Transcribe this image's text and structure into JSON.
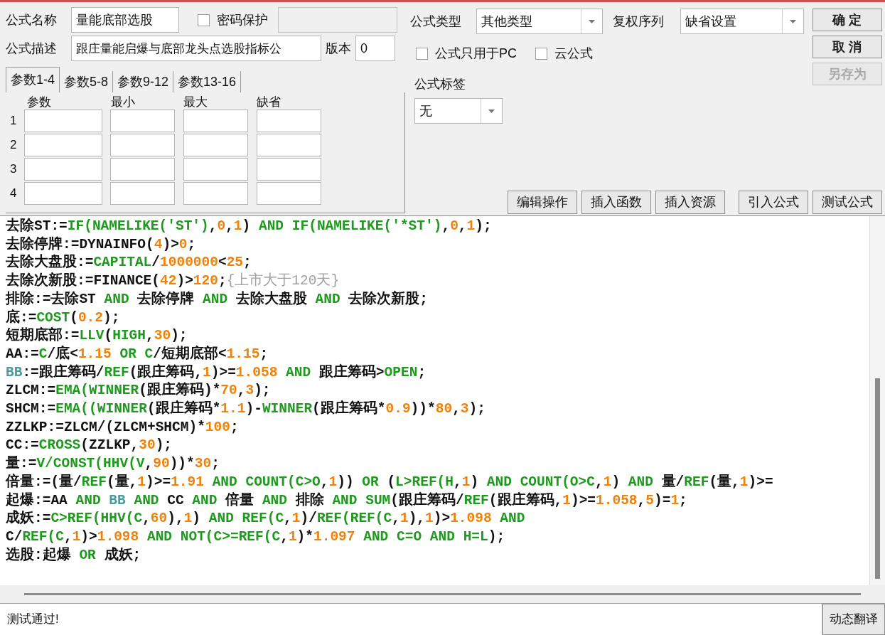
{
  "formula_name": {
    "label": "公式名称",
    "value": "量能底部选股"
  },
  "password": {
    "label": "密码保护",
    "checked": false
  },
  "description": {
    "label": "公式描述",
    "value": "跟庄量能启爆与底部龙头点选股指标公"
  },
  "version": {
    "label": "版本",
    "value": "0"
  },
  "param_tabs": [
    {
      "label": "参数1-4",
      "selected": true
    },
    {
      "label": "参数5-8",
      "selected": false
    },
    {
      "label": "参数9-12",
      "selected": false
    },
    {
      "label": "参数13-16",
      "selected": false
    }
  ],
  "param_table": {
    "columns": [
      "参数",
      "最小",
      "最大",
      "缺省"
    ],
    "rows": [
      "1",
      "2",
      "3",
      "4"
    ]
  },
  "formula_type": {
    "label": "公式类型",
    "value": "其他类型"
  },
  "adjust_sequence": {
    "label": "复权序列",
    "value": "缺省设置"
  },
  "options": [
    {
      "label": "公式只用于PC",
      "checked": false
    },
    {
      "label": "云公式",
      "checked": false
    }
  ],
  "formula_tag": {
    "label": "公式标签",
    "value": "无"
  },
  "dialog_buttons": [
    {
      "label": "确 定",
      "disabled": false
    },
    {
      "label": "取 消",
      "disabled": false
    },
    {
      "label": "另存为",
      "disabled": true
    }
  ],
  "tool_buttons": [
    "编辑操作",
    "插入函数",
    "插入资源",
    "引入公式",
    "测试公式"
  ],
  "code_lines": [
    {
      "tokens": [
        {
          "kind": "text",
          "text": "去除ST:="
        },
        {
          "kind": "function",
          "text": "IF(NAMELIKE('ST')"
        },
        {
          "kind": "text",
          "text": ","
        },
        {
          "kind": "number",
          "text": "0"
        },
        {
          "kind": "text",
          "text": ","
        },
        {
          "kind": "number",
          "text": "1"
        },
        {
          "kind": "text",
          "text": ") "
        },
        {
          "kind": "function",
          "text": "AND IF(NAMELIKE('*ST')"
        },
        {
          "kind": "text",
          "text": ","
        },
        {
          "kind": "number",
          "text": "0"
        },
        {
          "kind": "text",
          "text": ","
        },
        {
          "kind": "number",
          "text": "1"
        },
        {
          "kind": "text",
          "text": ");"
        }
      ]
    },
    {
      "tokens": [
        {
          "kind": "text",
          "text": "去除停牌:=DYNAINFO("
        },
        {
          "kind": "number",
          "text": "4"
        },
        {
          "kind": "text",
          "text": ")>"
        },
        {
          "kind": "number",
          "text": "0"
        },
        {
          "kind": "text",
          "text": ";"
        }
      ]
    },
    {
      "tokens": [
        {
          "kind": "text",
          "text": "去除大盘股:="
        },
        {
          "kind": "function",
          "text": "CAPITAL"
        },
        {
          "kind": "text",
          "text": "/"
        },
        {
          "kind": "number",
          "text": "1000000"
        },
        {
          "kind": "text",
          "text": "<"
        },
        {
          "kind": "number",
          "text": "25"
        },
        {
          "kind": "text",
          "text": ";"
        }
      ]
    },
    {
      "tokens": [
        {
          "kind": "text",
          "text": "去除次新股:=FINANCE("
        },
        {
          "kind": "number",
          "text": "42"
        },
        {
          "kind": "text",
          "text": ")>"
        },
        {
          "kind": "number",
          "text": "120"
        },
        {
          "kind": "text",
          "text": ";"
        },
        {
          "kind": "comment",
          "text": "{上市大于120天}"
        }
      ]
    },
    {
      "tokens": [
        {
          "kind": "text",
          "text": "排除:=去除ST "
        },
        {
          "kind": "function",
          "text": "AND"
        },
        {
          "kind": "text",
          "text": " 去除停牌 "
        },
        {
          "kind": "function",
          "text": "AND"
        },
        {
          "kind": "text",
          "text": " 去除大盘股 "
        },
        {
          "kind": "function",
          "text": "AND"
        },
        {
          "kind": "text",
          "text": " 去除次新股;"
        }
      ]
    },
    {
      "tokens": [
        {
          "kind": "text",
          "text": "底:="
        },
        {
          "kind": "function",
          "text": "COST"
        },
        {
          "kind": "text",
          "text": "("
        },
        {
          "kind": "number",
          "text": "0.2"
        },
        {
          "kind": "text",
          "text": ");"
        }
      ]
    },
    {
      "tokens": [
        {
          "kind": "text",
          "text": "短期底部:="
        },
        {
          "kind": "function",
          "text": "LLV"
        },
        {
          "kind": "text",
          "text": "("
        },
        {
          "kind": "function",
          "text": "HIGH"
        },
        {
          "kind": "text",
          "text": ","
        },
        {
          "kind": "number",
          "text": "30"
        },
        {
          "kind": "text",
          "text": ");"
        }
      ]
    },
    {
      "tokens": [
        {
          "kind": "text",
          "text": "AA:="
        },
        {
          "kind": "function",
          "text": "C"
        },
        {
          "kind": "text",
          "text": "/底<"
        },
        {
          "kind": "number",
          "text": "1.15"
        },
        {
          "kind": "function",
          "text": " OR C"
        },
        {
          "kind": "text",
          "text": "/短期底部<"
        },
        {
          "kind": "number",
          "text": "1.15"
        },
        {
          "kind": "text",
          "text": ";"
        }
      ]
    },
    {
      "tokens": [
        {
          "kind": "variable",
          "text": "BB"
        },
        {
          "kind": "text",
          "text": ":=跟庄筹码/"
        },
        {
          "kind": "function",
          "text": "REF"
        },
        {
          "kind": "text",
          "text": "(跟庄筹码,"
        },
        {
          "kind": "number",
          "text": "1"
        },
        {
          "kind": "text",
          "text": ")>="
        },
        {
          "kind": "number",
          "text": "1.058"
        },
        {
          "kind": "function",
          "text": " AND"
        },
        {
          "kind": "text",
          "text": " 跟庄筹码>"
        },
        {
          "kind": "function",
          "text": "OPEN"
        },
        {
          "kind": "text",
          "text": ";"
        }
      ]
    },
    {
      "tokens": [
        {
          "kind": "text",
          "text": "ZLCM:="
        },
        {
          "kind": "function",
          "text": "EMA(WINNER"
        },
        {
          "kind": "text",
          "text": "(跟庄筹码)*"
        },
        {
          "kind": "number",
          "text": "70"
        },
        {
          "kind": "text",
          "text": ","
        },
        {
          "kind": "number",
          "text": "3"
        },
        {
          "kind": "text",
          "text": ");"
        }
      ]
    },
    {
      "tokens": [
        {
          "kind": "text",
          "text": "SHCM:="
        },
        {
          "kind": "function",
          "text": "EMA((WINNER"
        },
        {
          "kind": "text",
          "text": "(跟庄筹码*"
        },
        {
          "kind": "number",
          "text": "1.1"
        },
        {
          "kind": "text",
          "text": ")-"
        },
        {
          "kind": "function",
          "text": "WINNER"
        },
        {
          "kind": "text",
          "text": "(跟庄筹码*"
        },
        {
          "kind": "number",
          "text": "0.9"
        },
        {
          "kind": "text",
          "text": "))*"
        },
        {
          "kind": "number",
          "text": "80"
        },
        {
          "kind": "text",
          "text": ","
        },
        {
          "kind": "number",
          "text": "3"
        },
        {
          "kind": "text",
          "text": ");"
        }
      ]
    },
    {
      "tokens": [
        {
          "kind": "text",
          "text": "ZZLKP:=ZLCM/(ZLCM+SHCM)*"
        },
        {
          "kind": "number",
          "text": "100"
        },
        {
          "kind": "text",
          "text": ";"
        }
      ]
    },
    {
      "tokens": [
        {
          "kind": "text",
          "text": "CC:="
        },
        {
          "kind": "function",
          "text": "CROSS"
        },
        {
          "kind": "text",
          "text": "(ZZLKP,"
        },
        {
          "kind": "number",
          "text": "30"
        },
        {
          "kind": "text",
          "text": ");"
        }
      ]
    },
    {
      "tokens": [
        {
          "kind": "text",
          "text": "量:="
        },
        {
          "kind": "function",
          "text": "V/CONST(HHV(V"
        },
        {
          "kind": "text",
          "text": ","
        },
        {
          "kind": "number",
          "text": "90"
        },
        {
          "kind": "text",
          "text": "))*"
        },
        {
          "kind": "number",
          "text": "30"
        },
        {
          "kind": "text",
          "text": ";"
        }
      ]
    },
    {
      "tokens": [
        {
          "kind": "text",
          "text": "倍量:=(量/"
        },
        {
          "kind": "function",
          "text": "REF"
        },
        {
          "kind": "text",
          "text": "(量,"
        },
        {
          "kind": "number",
          "text": "1"
        },
        {
          "kind": "text",
          "text": ")>="
        },
        {
          "kind": "number",
          "text": "1.91"
        },
        {
          "kind": "function",
          "text": " AND COUNT(C>O"
        },
        {
          "kind": "text",
          "text": ","
        },
        {
          "kind": "number",
          "text": "1"
        },
        {
          "kind": "text",
          "text": ")) "
        },
        {
          "kind": "function",
          "text": "OR"
        },
        {
          "kind": "text",
          "text": " ("
        },
        {
          "kind": "function",
          "text": "L>REF(H"
        },
        {
          "kind": "text",
          "text": ","
        },
        {
          "kind": "number",
          "text": "1"
        },
        {
          "kind": "text",
          "text": ") "
        },
        {
          "kind": "function",
          "text": "AND COUNT(O>C"
        },
        {
          "kind": "text",
          "text": ","
        },
        {
          "kind": "number",
          "text": "1"
        },
        {
          "kind": "text",
          "text": ") "
        },
        {
          "kind": "function",
          "text": "AND"
        },
        {
          "kind": "text",
          "text": " 量/"
        },
        {
          "kind": "function",
          "text": "REF"
        },
        {
          "kind": "text",
          "text": "(量,"
        },
        {
          "kind": "number",
          "text": "1"
        },
        {
          "kind": "text",
          "text": ")>="
        }
      ]
    },
    {
      "tokens": [
        {
          "kind": "text",
          "text": "起爆:=AA "
        },
        {
          "kind": "function",
          "text": "AND"
        },
        {
          "kind": "variable",
          "text": " BB"
        },
        {
          "kind": "function",
          "text": " AND"
        },
        {
          "kind": "text",
          "text": " CC "
        },
        {
          "kind": "function",
          "text": "AND"
        },
        {
          "kind": "text",
          "text": " 倍量 "
        },
        {
          "kind": "function",
          "text": "AND"
        },
        {
          "kind": "text",
          "text": " 排除 "
        },
        {
          "kind": "function",
          "text": "AND SUM"
        },
        {
          "kind": "text",
          "text": "(跟庄筹码/"
        },
        {
          "kind": "function",
          "text": "REF"
        },
        {
          "kind": "text",
          "text": "(跟庄筹码,"
        },
        {
          "kind": "number",
          "text": "1"
        },
        {
          "kind": "text",
          "text": ")>="
        },
        {
          "kind": "number",
          "text": "1.058"
        },
        {
          "kind": "text",
          "text": ","
        },
        {
          "kind": "number",
          "text": "5"
        },
        {
          "kind": "text",
          "text": ")="
        },
        {
          "kind": "number",
          "text": "1"
        },
        {
          "kind": "text",
          "text": ";"
        }
      ]
    },
    {
      "tokens": [
        {
          "kind": "text",
          "text": "成妖:="
        },
        {
          "kind": "function",
          "text": "C>REF(HHV(C"
        },
        {
          "kind": "text",
          "text": ","
        },
        {
          "kind": "number",
          "text": "60"
        },
        {
          "kind": "text",
          "text": "),"
        },
        {
          "kind": "number",
          "text": "1"
        },
        {
          "kind": "text",
          "text": ") "
        },
        {
          "kind": "function",
          "text": "AND REF(C"
        },
        {
          "kind": "text",
          "text": ","
        },
        {
          "kind": "number",
          "text": "1"
        },
        {
          "kind": "text",
          "text": ")/"
        },
        {
          "kind": "function",
          "text": "REF(REF(C"
        },
        {
          "kind": "text",
          "text": ","
        },
        {
          "kind": "number",
          "text": "1"
        },
        {
          "kind": "text",
          "text": "),"
        },
        {
          "kind": "number",
          "text": "1"
        },
        {
          "kind": "text",
          "text": ")>"
        },
        {
          "kind": "number",
          "text": "1.098"
        },
        {
          "kind": "function",
          "text": " AND"
        }
      ]
    },
    {
      "tokens": [
        {
          "kind": "text",
          "text": "C/"
        },
        {
          "kind": "function",
          "text": "REF(C"
        },
        {
          "kind": "text",
          "text": ","
        },
        {
          "kind": "number",
          "text": "1"
        },
        {
          "kind": "text",
          "text": ")>"
        },
        {
          "kind": "number",
          "text": "1.098"
        },
        {
          "kind": "function",
          "text": " AND NOT(C>=REF(C"
        },
        {
          "kind": "text",
          "text": ","
        },
        {
          "kind": "number",
          "text": "1"
        },
        {
          "kind": "text",
          "text": ")*"
        },
        {
          "kind": "number",
          "text": "1.097"
        },
        {
          "kind": "function",
          "text": " AND C=O AND H=L"
        },
        {
          "kind": "text",
          "text": ");"
        }
      ]
    },
    {
      "tokens": [
        {
          "kind": "text",
          "text": "选股:起爆 "
        },
        {
          "kind": "function",
          "text": "OR"
        },
        {
          "kind": "text",
          "text": " 成妖;"
        }
      ]
    }
  ],
  "status": {
    "message": "测试通过!",
    "button": "动态翻译"
  }
}
